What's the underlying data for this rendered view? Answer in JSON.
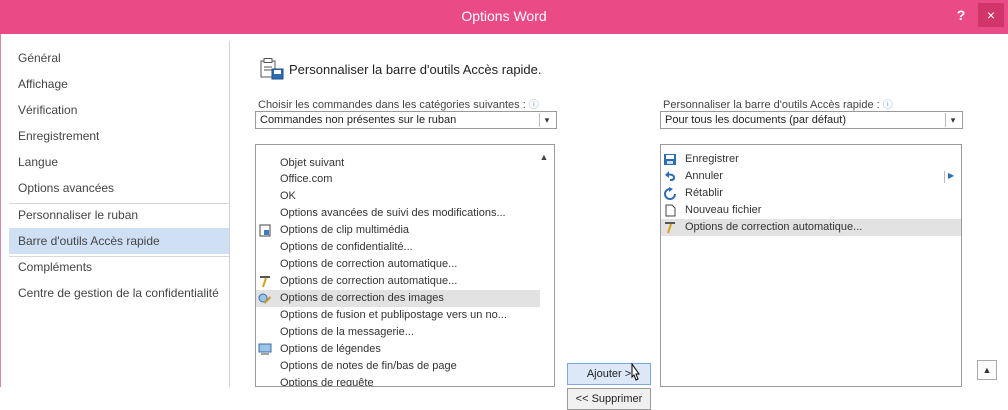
{
  "window": {
    "title": "Options Word",
    "help_label": "?",
    "close_label": "×"
  },
  "nav": {
    "items": [
      {
        "label": "Général"
      },
      {
        "label": "Affichage"
      },
      {
        "label": "Vérification"
      },
      {
        "label": "Enregistrement"
      },
      {
        "label": "Langue"
      },
      {
        "label": "Options avancées"
      },
      {
        "label": "Personnaliser le ruban"
      },
      {
        "label": "Barre d'outils Accès rapide",
        "active": true
      },
      {
        "label": "Compléments"
      },
      {
        "label": "Centre de gestion de la confidentialité"
      }
    ]
  },
  "main": {
    "title": "Personnaliser la barre d'outils Accès rapide.",
    "left_label": "Choisir les commandes dans les catégories suivantes :",
    "left_select": "Commandes non présentes sur le ruban",
    "right_label": "Personnaliser la barre d'outils Accès rapide :",
    "right_select": "Pour tous les documents (par défaut)",
    "info_glyph": "ⓘ"
  },
  "commands": [
    {
      "label": "Objet suivant",
      "icon": ""
    },
    {
      "label": "Office.com",
      "icon": ""
    },
    {
      "label": "OK",
      "icon": ""
    },
    {
      "label": "Options avancées de suivi des modifications...",
      "icon": ""
    },
    {
      "label": "Options de clip multimédia",
      "icon": "clip-media-icon"
    },
    {
      "label": "Options de confidentialité...",
      "icon": ""
    },
    {
      "label": "Options de correction automatique...",
      "icon": ""
    },
    {
      "label": "Options de correction automatique...",
      "icon": "autocorrect-icon"
    },
    {
      "label": "Options de correction des images",
      "icon": "image-correction-icon",
      "selected": true
    },
    {
      "label": "Options de fusion et publipostage vers un no...",
      "icon": ""
    },
    {
      "label": "Options de la messagerie...",
      "icon": ""
    },
    {
      "label": "Options de légendes",
      "icon": "captions-icon"
    },
    {
      "label": "Options de notes de fin/bas de page",
      "icon": ""
    },
    {
      "label": "Options de requête",
      "icon": ""
    }
  ],
  "toolbar_items": [
    {
      "label": "Enregistrer",
      "icon": "save-icon"
    },
    {
      "label": "Annuler",
      "icon": "undo-icon"
    },
    {
      "label": "Rétablir",
      "icon": "redo-icon"
    },
    {
      "label": "Nouveau fichier",
      "icon": "new-file-icon"
    },
    {
      "label": "Options de correction automatique...",
      "icon": "autocorrect-icon",
      "selected": true
    }
  ],
  "buttons": {
    "add": "Ajouter >",
    "remove": "<< Supprimer"
  },
  "colors": {
    "titlebar": "#ea4a85",
    "nav_active": "#cfe0f5",
    "selection": "#e2e2e2"
  }
}
